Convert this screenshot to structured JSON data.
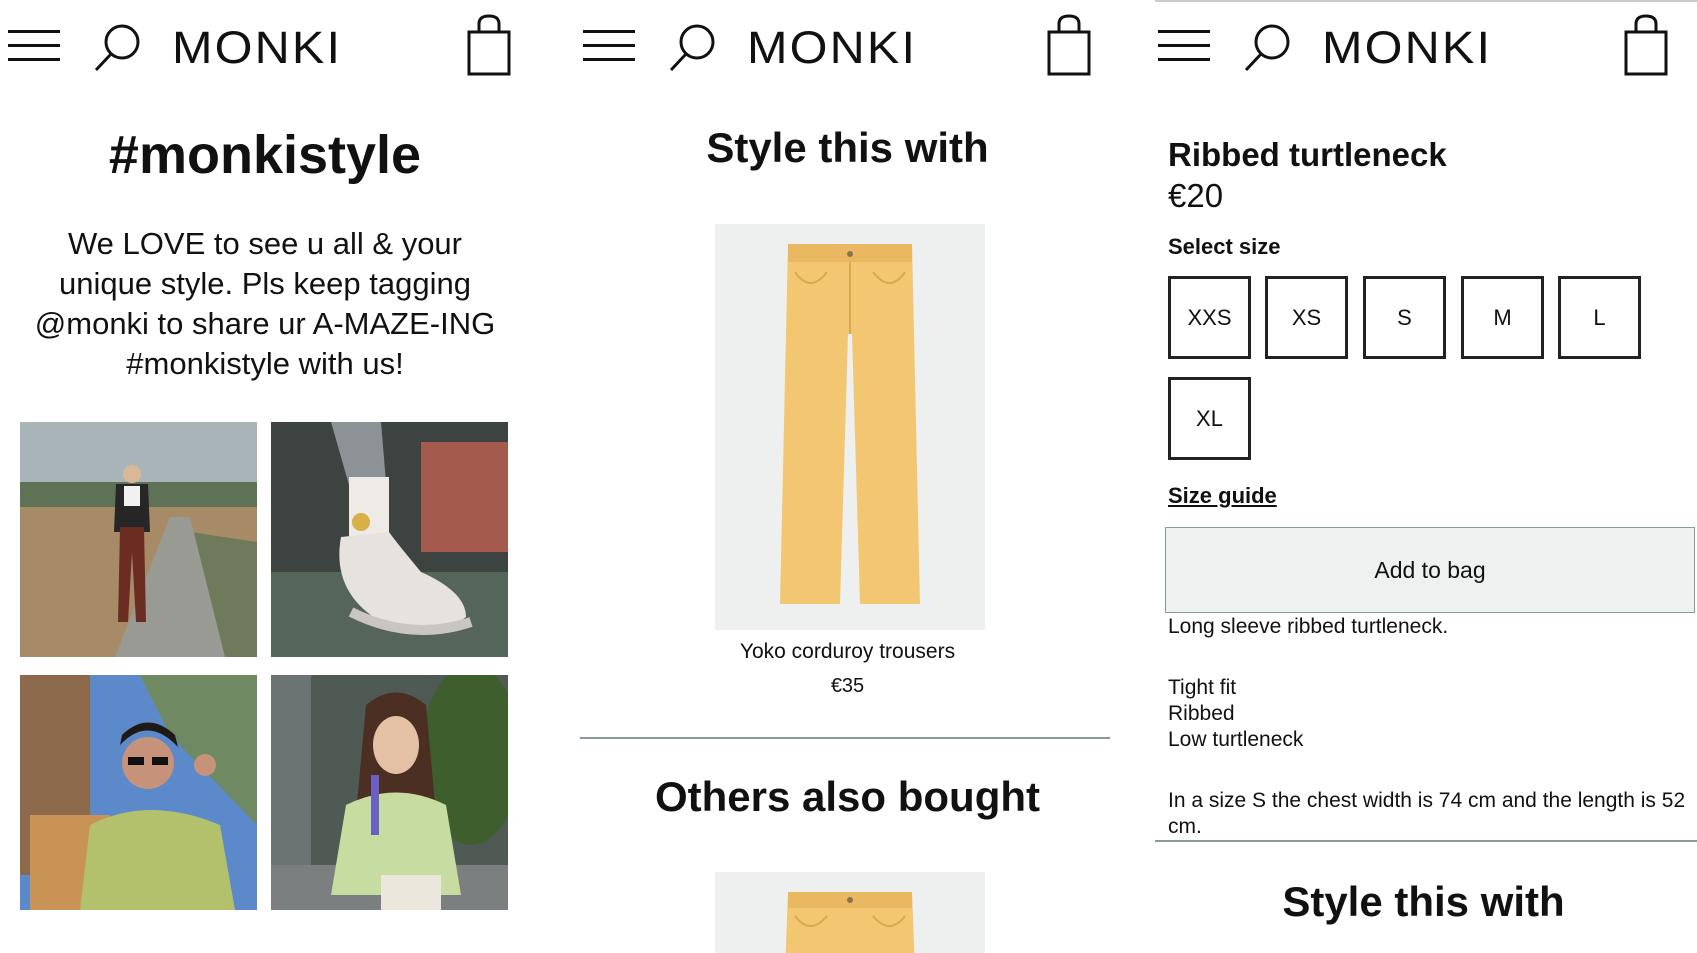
{
  "header": {
    "logo": "MONKI",
    "icons": [
      "menu-icon",
      "search-icon",
      "shopping-bag-icon"
    ]
  },
  "panel1": {
    "title": "#monkistyle",
    "intro": "We LOVE to see u all & your unique style. Pls keep tagging @monki to share ur A-MAZE-ING #monkistyle with us!",
    "photos": [
      "user-photo-field-path",
      "user-photo-sneakers",
      "user-photo-sunglasses",
      "user-photo-green-cardigan"
    ]
  },
  "panel2": {
    "section_title": "Style this with",
    "product": {
      "name": "Yoko corduroy trousers",
      "price": "€35",
      "color": "#f3c672"
    },
    "others_title": "Others also bought"
  },
  "panel3": {
    "product_name": "Ribbed turtleneck",
    "price": "€20",
    "select_size_label": "Select size",
    "sizes": [
      "XXS",
      "XS",
      "S",
      "M",
      "L",
      "XL"
    ],
    "size_guide": "Size guide",
    "add_to_bag": "Add to bag",
    "description": "Long sleeve ribbed turtleneck.",
    "features": [
      "Tight fit",
      "Ribbed",
      "Low turtleneck"
    ],
    "measurements": "In a size S the chest width is 74 cm and the length is 52 cm.",
    "style_title": "Style this with"
  },
  "colors": {
    "text": "#111111",
    "button_bg": "#eef1f0",
    "divider": "#8a9a9a",
    "product_bg": "#eef0ef"
  }
}
